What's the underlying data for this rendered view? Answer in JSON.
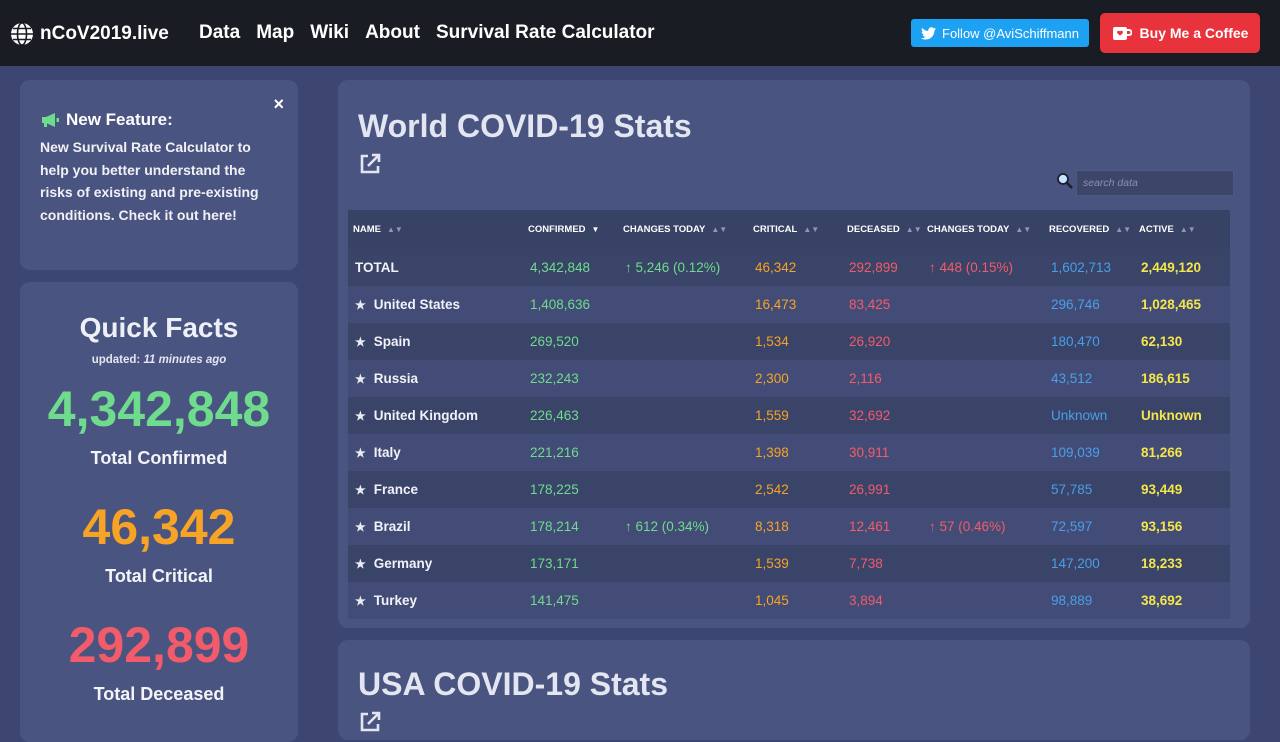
{
  "brand": {
    "name": "nCoV2019.live",
    "icon": "globe-icon"
  },
  "nav": [
    "Data",
    "Map",
    "Wiki",
    "About",
    "Survival Rate Calculator"
  ],
  "buttons": {
    "twitter": "Follow @AviSchiffmann",
    "coffee": "Buy Me a Coffee"
  },
  "feature": {
    "title": "New Feature:",
    "text": "New Survival Rate Calculator to help you better understand the risks of existing and pre-existing conditions. Check it out here!",
    "close": "×"
  },
  "quick_facts": {
    "title": "Quick Facts",
    "updated_prefix": "updated: ",
    "updated_value": "11 minutes ago",
    "confirmed": "4,342,848",
    "confirmed_label": "Total Confirmed",
    "critical": "46,342",
    "critical_label": "Total Critical",
    "deceased": "292,899",
    "deceased_label": "Total Deceased"
  },
  "colors": {
    "green": "#6edc8c",
    "orange": "#f7a325",
    "red": "#f25b6a",
    "blue": "#4a9fe8",
    "yellow": "#f4e64b"
  },
  "world": {
    "title": "World COVID-19 Stats",
    "search_placeholder": "search data",
    "columns": [
      "NAME",
      "CONFIRMED",
      "CHANGES TODAY",
      "CRITICAL",
      "DECEASED",
      "CHANGES TODAY",
      "RECOVERED",
      "ACTIVE"
    ],
    "rows": [
      {
        "name": "TOTAL",
        "star": false,
        "confirmed": "4,342,848",
        "conf_change": "↑ 5,246 (0.12%)",
        "critical": "46,342",
        "deceased": "292,899",
        "dec_change": "↑ 448 (0.15%)",
        "recovered": "1,602,713",
        "active": "2,449,120"
      },
      {
        "name": "United States",
        "star": true,
        "confirmed": "1,408,636",
        "conf_change": "",
        "critical": "16,473",
        "deceased": "83,425",
        "dec_change": "",
        "recovered": "296,746",
        "active": "1,028,465"
      },
      {
        "name": "Spain",
        "star": true,
        "confirmed": "269,520",
        "conf_change": "",
        "critical": "1,534",
        "deceased": "26,920",
        "dec_change": "",
        "recovered": "180,470",
        "active": "62,130"
      },
      {
        "name": "Russia",
        "star": true,
        "confirmed": "232,243",
        "conf_change": "",
        "critical": "2,300",
        "deceased": "2,116",
        "dec_change": "",
        "recovered": "43,512",
        "active": "186,615"
      },
      {
        "name": "United Kingdom",
        "star": true,
        "confirmed": "226,463",
        "conf_change": "",
        "critical": "1,559",
        "deceased": "32,692",
        "dec_change": "",
        "recovered": "Unknown",
        "active": "Unknown"
      },
      {
        "name": "Italy",
        "star": true,
        "confirmed": "221,216",
        "conf_change": "",
        "critical": "1,398",
        "deceased": "30,911",
        "dec_change": "",
        "recovered": "109,039",
        "active": "81,266"
      },
      {
        "name": "France",
        "star": true,
        "confirmed": "178,225",
        "conf_change": "",
        "critical": "2,542",
        "deceased": "26,991",
        "dec_change": "",
        "recovered": "57,785",
        "active": "93,449"
      },
      {
        "name": "Brazil",
        "star": true,
        "confirmed": "178,214",
        "conf_change": "↑ 612 (0.34%)",
        "critical": "8,318",
        "deceased": "12,461",
        "dec_change": "↑ 57 (0.46%)",
        "recovered": "72,597",
        "active": "93,156"
      },
      {
        "name": "Germany",
        "star": true,
        "confirmed": "173,171",
        "conf_change": "",
        "critical": "1,539",
        "deceased": "7,738",
        "dec_change": "",
        "recovered": "147,200",
        "active": "18,233"
      },
      {
        "name": "Turkey",
        "star": true,
        "confirmed": "141,475",
        "conf_change": "",
        "critical": "1,045",
        "deceased": "3,894",
        "dec_change": "",
        "recovered": "98,889",
        "active": "38,692"
      }
    ]
  },
  "usa": {
    "title": "USA COVID-19 Stats"
  }
}
